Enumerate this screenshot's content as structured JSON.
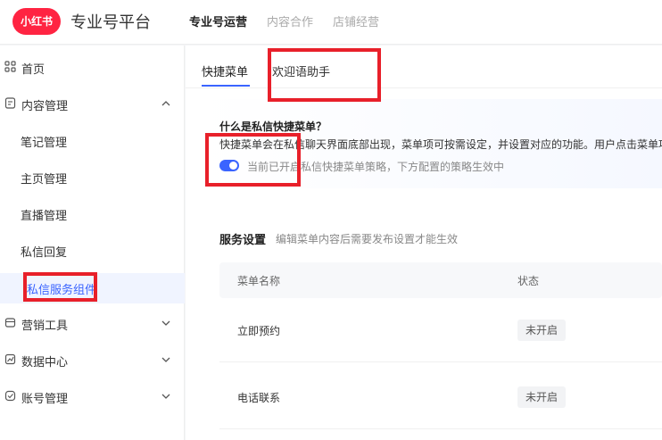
{
  "header": {
    "logo_text": "小红书",
    "platform_title": "专业号平台",
    "nav": [
      {
        "label": "专业号运营"
      },
      {
        "label": "内容合作"
      },
      {
        "label": "店铺经营"
      }
    ]
  },
  "sidebar": {
    "items": [
      {
        "label": "首页"
      },
      {
        "label": "内容管理"
      },
      {
        "label": "笔记管理"
      },
      {
        "label": "主页管理"
      },
      {
        "label": "直播管理"
      },
      {
        "label": "私信回复"
      },
      {
        "label": "私信服务组件"
      },
      {
        "label": "营销工具"
      },
      {
        "label": "数据中心"
      },
      {
        "label": "账号管理"
      }
    ]
  },
  "main": {
    "tabs": [
      {
        "label": "快捷菜单"
      },
      {
        "label": "欢迎语助手"
      }
    ],
    "info": {
      "title": "什么是私信快捷菜单？",
      "description": "快捷菜单会在私信聊天界面底部出现，菜单项可按需设定，并设置对应的功能。用户点击菜单项",
      "toggle_text": "当前已开启私信快捷菜单策略，下方配置的策略生效中"
    },
    "service": {
      "title": "服务设置",
      "hint": "编辑菜单内容后需要发布设置才能生效"
    },
    "table": {
      "headers": [
        "菜单名称",
        "状态"
      ],
      "rows": [
        {
          "name": "立即预约",
          "status": "未开启"
        },
        {
          "name": "电话联系",
          "status": "未开启"
        }
      ]
    }
  },
  "colors": {
    "brand": "#ff2442",
    "accent": "#3a64ff",
    "highlight": "#e8202a"
  }
}
